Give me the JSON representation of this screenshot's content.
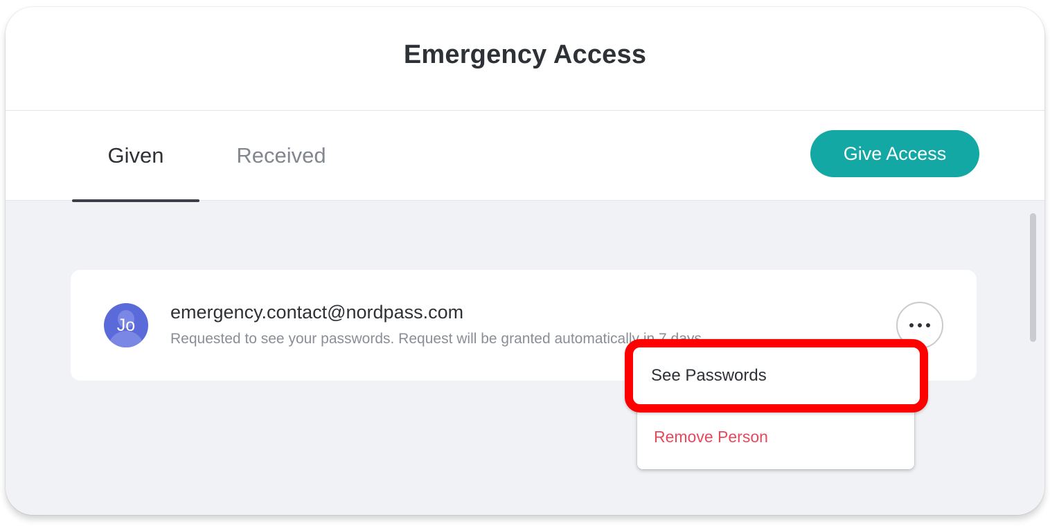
{
  "header": {
    "title": "Emergency Access"
  },
  "tabs": [
    {
      "label": "Given",
      "active": true
    },
    {
      "label": "Received",
      "active": false
    }
  ],
  "actions": {
    "give_access_label": "Give Access"
  },
  "contacts": [
    {
      "avatar_initials": "Jo",
      "email": "emergency.contact@nordpass.com",
      "status": "Requested to see your passwords. Request will be granted automatically in 7 days."
    }
  ],
  "menu": {
    "items": [
      {
        "label": "See Passwords"
      },
      {
        "label": "Remove Person"
      }
    ]
  },
  "icons": {
    "more": "more-horizontal-icon"
  },
  "colors": {
    "accent": "#13a8a4",
    "danger": "#e6495b",
    "avatar": "#5a6ad8",
    "highlight_border": "#ff0000"
  }
}
